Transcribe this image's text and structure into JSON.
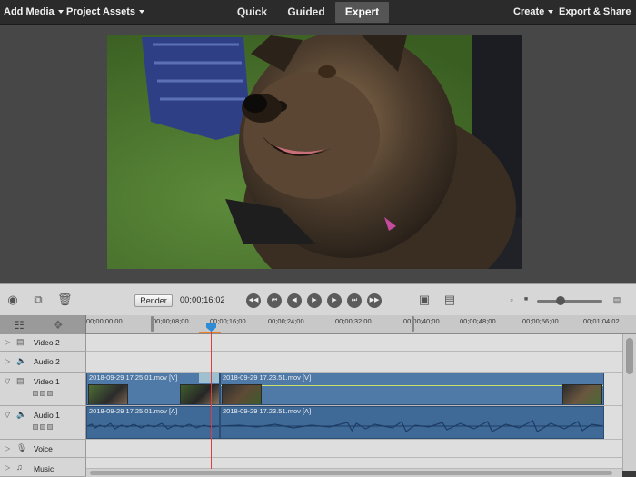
{
  "menu": {
    "add_media": "Add Media",
    "project_assets": "Project Assets",
    "create": "Create",
    "export_share": "Export & Share"
  },
  "modes": {
    "quick": "Quick",
    "guided": "Guided",
    "expert": "Expert",
    "active": "Expert"
  },
  "toolbar": {
    "render_label": "Render",
    "timecode": "00;00;16;02"
  },
  "ruler": {
    "labels": [
      "00;00;00;00",
      "00;00;08;00",
      "00;00;16;00",
      "00;00;24;00",
      "00;00;32;00",
      "00;00;40;00",
      "00;00;48;00",
      "00;00;56;00",
      "00;01;04;02"
    ]
  },
  "tracks": {
    "video2": "Video 2",
    "audio2": "Audio 2",
    "video1": "Video 1",
    "audio1": "Audio 1",
    "voice": "Voice",
    "music": "Music"
  },
  "clips": {
    "v1_clip1": "2018-09-29 17.25.01.mov [V]",
    "v1_clip2": "2018-09-29 17.23.51.mov [V]",
    "a1_clip1": "2018-09-29 17.25.01.mov [A]",
    "a1_clip2": "2018-09-29 17.23.51.mov [A]"
  },
  "colors": {
    "clip_video": "#4f79a6",
    "clip_audio": "#3f6a98",
    "playhead": "#e23b3b",
    "active_mode_bg": "#555555"
  },
  "icons": [
    "camera-icon",
    "link-icon",
    "trash-icon",
    "goto-start-icon",
    "prev-edit-icon",
    "step-back-icon",
    "play-icon",
    "step-forward-icon",
    "next-edit-icon",
    "goto-end-icon",
    "monitor-icon",
    "fullscreen-icon"
  ]
}
